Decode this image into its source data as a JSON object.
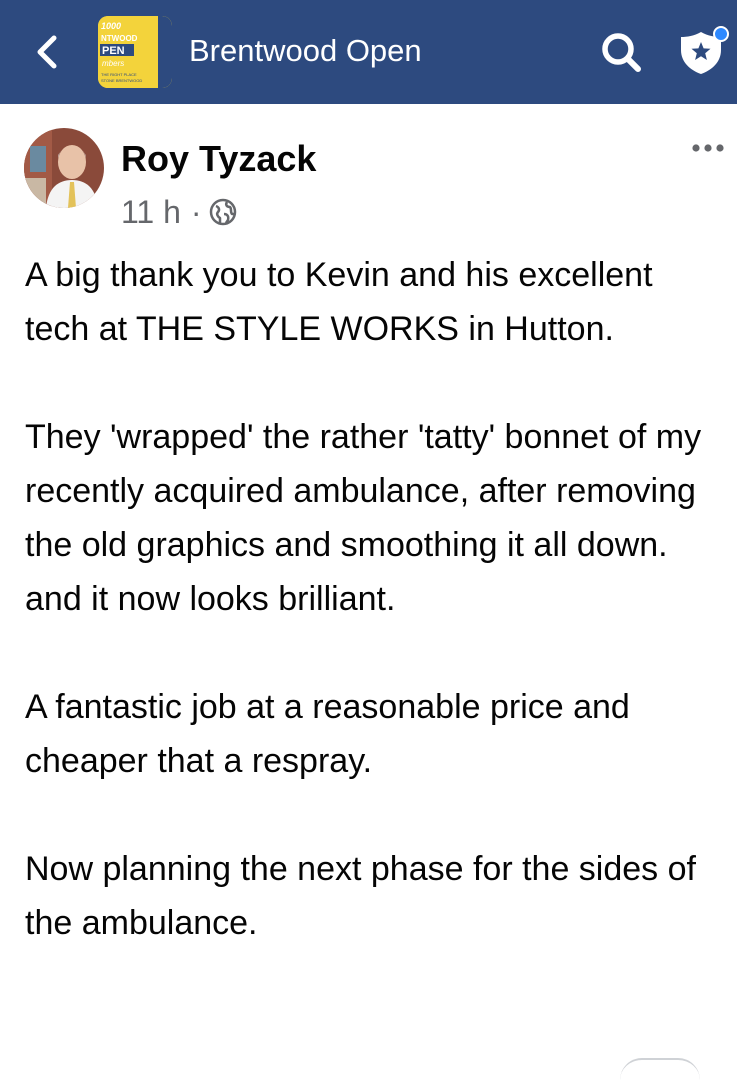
{
  "header": {
    "title": "Brentwood Open",
    "back_icon": "chevron-left-icon",
    "search_icon": "search-icon",
    "admin_icon": "shield-star-icon",
    "bar_color": "#2d4a7f",
    "notification_dot_color": "#2e89ff",
    "group_thumb_text": {
      "line1": "1000",
      "line2": "NTWOOD",
      "line3": "PEN",
      "line4": "mbers",
      "line5": "THE RIGHT PLACE",
      "line6": "STONE BRENTWOOD"
    }
  },
  "post": {
    "author": "Roy Tyzack",
    "time": "11 h",
    "separator": "·",
    "privacy_icon": "globe-icon",
    "more_icon": "more-horizontal-icon",
    "paragraphs": [
      "A big thank you to Kevin and his excellent tech at THE STYLE WORKS in Hutton.",
      "They 'wrapped' the rather 'tatty' bonnet of my recently acquired ambulance, after removing the old graphics and smoothing it all down. and it now looks brilliant.",
      "A fantastic job at a reasonable price and cheaper that a respray.",
      "Now planning the next phase for the sides of the ambulance."
    ]
  }
}
